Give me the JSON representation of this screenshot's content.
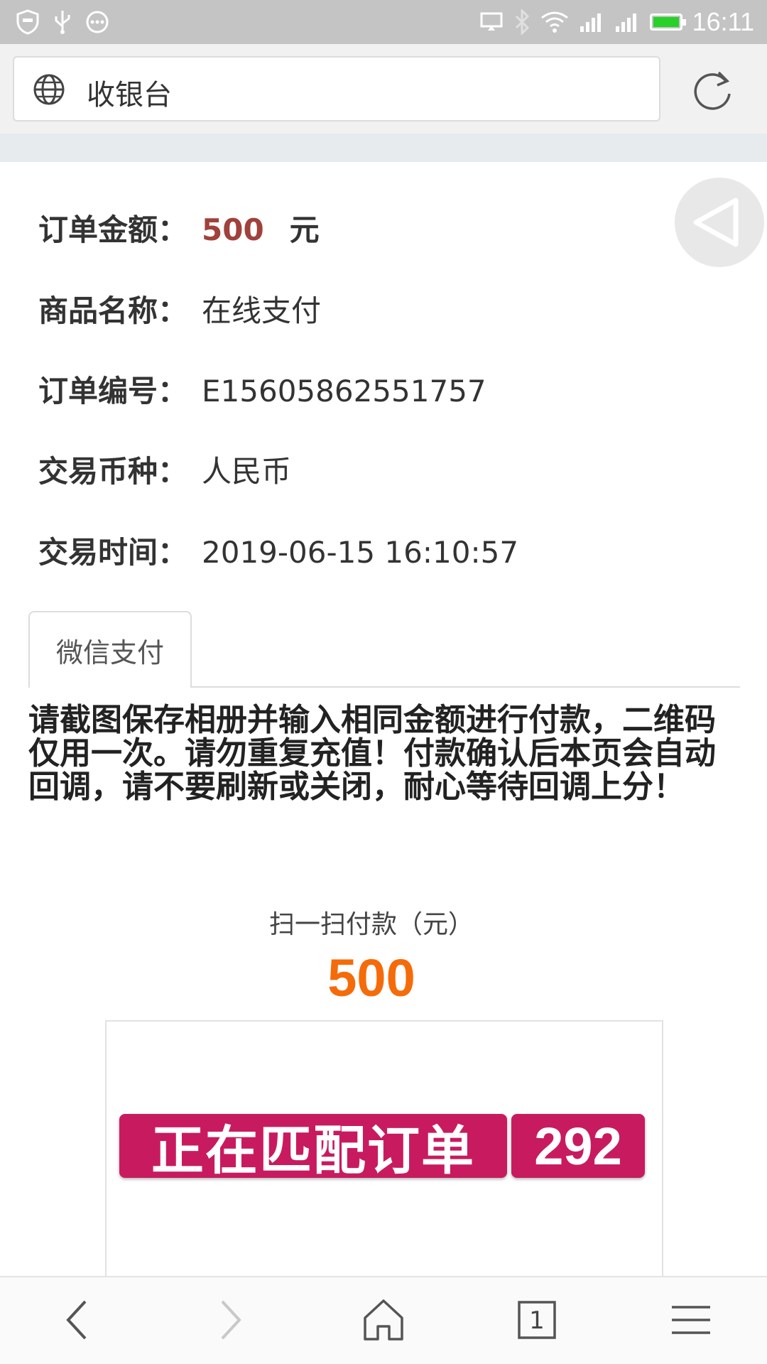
{
  "status_bar": {
    "time": "16:11",
    "left_icons": [
      "shield-icon",
      "usb-icon",
      "more-icon"
    ],
    "right_icons": [
      "cast-icon",
      "bluetooth-icon",
      "wifi-icon",
      "signal-icon",
      "signal-icon",
      "battery-icon"
    ],
    "battery_color": "#27d127"
  },
  "address_bar": {
    "title": "收银台"
  },
  "order": {
    "amount_label": "订单金额：",
    "amount_value": "500",
    "amount_unit": "元",
    "product_label": "商品名称：",
    "product_value": "在线支付",
    "order_no_label": "订单编号：",
    "order_no_value": "E15605862551757",
    "currency_label": "交易币种：",
    "currency_value": "人民币",
    "time_label": "交易时间：",
    "time_value": "2019-06-15 16:10:57"
  },
  "tabs": [
    {
      "label": "微信支付",
      "active": true
    }
  ],
  "notice": "请截图保存相册并输入相同金额进行付款，二维码仅用一次。请勿重复充值！付款确认后本页会自动回调，请不要刷新或关闭，耐心等待回调上分！",
  "payment": {
    "scan_label": "扫一扫付款（元）",
    "scan_amount": "500",
    "matching_label": "正在匹配订单",
    "countdown": "292"
  },
  "toolbar": {
    "tabs_count": "1",
    "icons": [
      "back-icon",
      "forward-icon",
      "home-icon",
      "tabs-icon",
      "menu-icon"
    ]
  },
  "colors": {
    "amount": "#a0413b",
    "scan_amount": "#f56b0a",
    "matching_bg": "#c81b5f"
  }
}
